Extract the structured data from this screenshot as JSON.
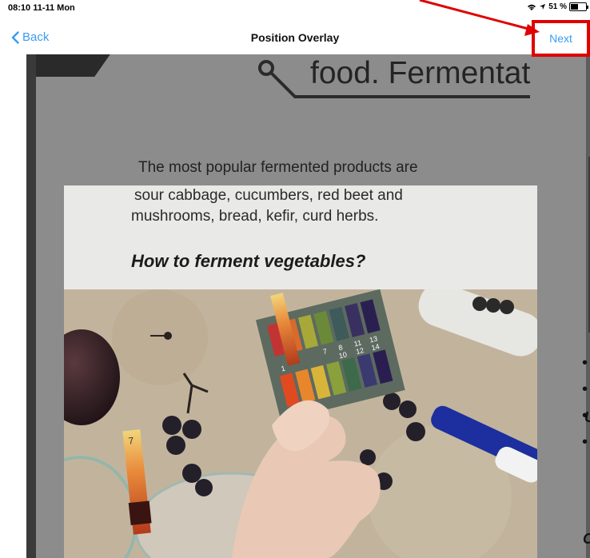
{
  "status": {
    "time": "08:10  11-11 Mon",
    "battery_text": "51 %",
    "battery_level": 0.51
  },
  "nav": {
    "back_label": "Back",
    "title": "Position Overlay",
    "next_label": "Next"
  },
  "camera": {
    "headline": "food. Fermentat",
    "paragraph_line": "The most popular fermented products are",
    "right_letter_u": "U",
    "right_letter_c": "C",
    "bullet": "•"
  },
  "overlay": {
    "line1": "sour cabbage, cucumbers, red beet and",
    "line2": "mushrooms, bread, kefir, curd herbs.",
    "heading": "How to ferment vegetables?",
    "ph_strip_label": "7",
    "ph_chart_numbers_top": [
      "7",
      "8",
      "11",
      "13"
    ],
    "ph_chart_numbers_bottom": [
      "1",
      "10",
      "12",
      "14"
    ]
  },
  "colors": {
    "accent": "#3a9cf2",
    "highlight": "#e00000"
  }
}
